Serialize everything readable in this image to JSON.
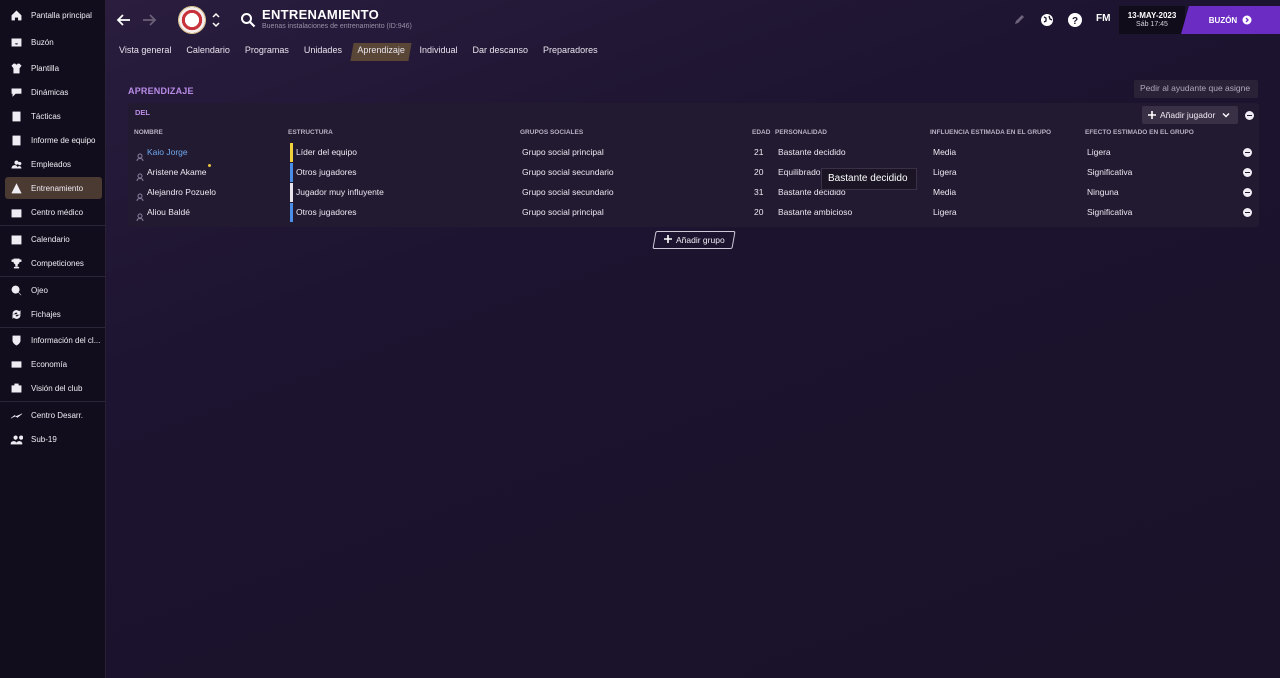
{
  "sidebar": {
    "items": [
      {
        "label": "Pantalla principal",
        "icon": "home-icon"
      },
      {
        "label": "Buzón",
        "icon": "inbox-icon"
      },
      {
        "label": "Plantilla",
        "icon": "shirt-icon"
      },
      {
        "label": "Dinámicas",
        "icon": "dynamics-icon"
      },
      {
        "label": "Tácticas",
        "icon": "tactics-icon"
      },
      {
        "label": "Informe de equipo",
        "icon": "report-icon"
      },
      {
        "label": "Empleados",
        "icon": "staff-icon"
      },
      {
        "label": "Entrenamiento",
        "icon": "training-icon"
      },
      {
        "label": "Centro médico",
        "icon": "medical-icon"
      },
      {
        "label": "Calendario",
        "icon": "calendar-icon"
      },
      {
        "label": "Competiciones",
        "icon": "trophy-icon"
      },
      {
        "label": "Ojeo",
        "icon": "scouting-icon"
      },
      {
        "label": "Fichajes",
        "icon": "transfers-icon"
      },
      {
        "label": "Información del cl...",
        "icon": "club-info-icon"
      },
      {
        "label": "Economía",
        "icon": "finances-icon"
      },
      {
        "label": "Visión del club",
        "icon": "club-vision-icon"
      },
      {
        "label": "Centro Desarr.",
        "icon": "development-icon"
      },
      {
        "label": "Sub-19",
        "icon": "u19-icon"
      }
    ],
    "active_index": 7
  },
  "header": {
    "title": "ENTRENAMIENTO",
    "subtitle": "Buenas instalaciones de entrenamiento (ID:946)",
    "fm_label": "FM",
    "date": "13-MAY-2023",
    "day_time": "Sáb 17:45",
    "inbox_label": "BUZÓN"
  },
  "tabs": [
    {
      "label": "Vista general",
      "active": false
    },
    {
      "label": "Calendario",
      "active": false
    },
    {
      "label": "Programas",
      "active": false
    },
    {
      "label": "Unidades",
      "active": false
    },
    {
      "label": "Aprendizaje",
      "active": true
    },
    {
      "label": "Individual",
      "active": false
    },
    {
      "label": "Dar descanso",
      "active": false
    },
    {
      "label": "Preparadores",
      "active": false
    }
  ],
  "ask_assistant": "Pedir al ayudante que asigne",
  "section_title": "APRENDIZAJE",
  "group": {
    "label": "DEL",
    "add_player_label": "Añadir jugador",
    "columns": {
      "name": "NOMBRE",
      "structure": "ESTRUCTURA",
      "social_groups": "GRUPOS SOCIALES",
      "age": "EDAD",
      "personality": "PERSONALIDAD",
      "influence": "INFLUENCIA ESTIMADA EN EL GRUPO",
      "effect": "EFECTO ESTIMADO EN EL GRUPO"
    },
    "rows": [
      {
        "name": "Kaio Jorge",
        "structure": "Líder del equipo",
        "structure_color": "#f2d23c",
        "social": "Grupo social principal",
        "age": "21",
        "personality": "Bastante decidido",
        "influence": "Media",
        "effect": "Ligera"
      },
      {
        "name": "Aristene Akame",
        "structure": "Otros jugadores",
        "structure_color": "#4a8ee8",
        "social": "Grupo social secundario",
        "age": "20",
        "personality": "Equilibrado",
        "influence": "Ligera",
        "effect": "Significativa"
      },
      {
        "name": "Alejandro Pozuelo",
        "structure": "Jugador muy influyente",
        "structure_color": "#e8e4ee",
        "social": "Grupo social secundario",
        "age": "31",
        "personality": "Bastante decidido",
        "influence": "Media",
        "effect": "Ninguna"
      },
      {
        "name": "Aliou Baldé",
        "structure": "Otros jugadores",
        "structure_color": "#4a8ee8",
        "social": "Grupo social principal",
        "age": "20",
        "personality": "Bastante ambicioso",
        "influence": "Ligera",
        "effect": "Significativa"
      }
    ]
  },
  "tooltip": "Bastante decidido",
  "add_group_label": "Añadir grupo",
  "colors": {
    "accent": "#6b2cc4",
    "section": "#b98ce8",
    "link": "#6fa8f0"
  }
}
